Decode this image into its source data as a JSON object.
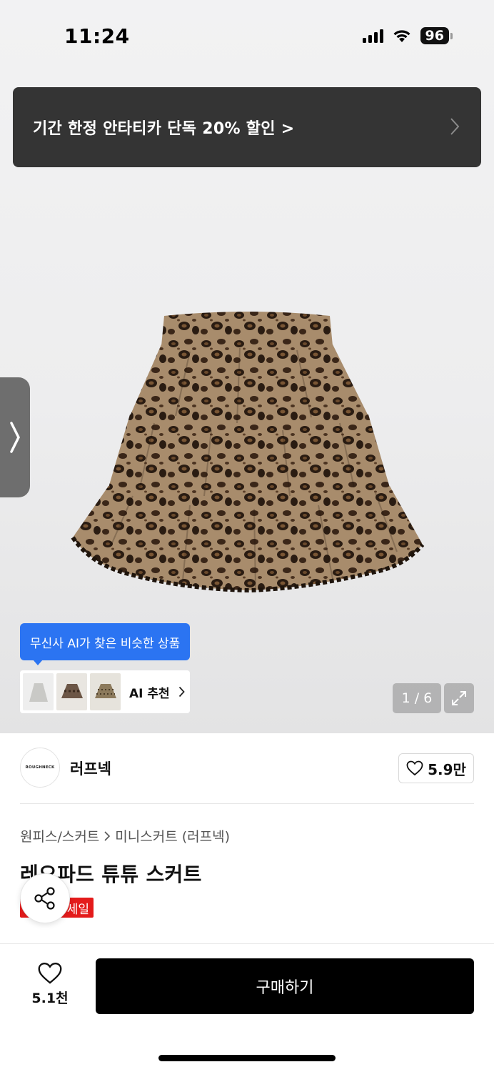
{
  "status_bar": {
    "time": "11:24",
    "battery": "96"
  },
  "promo_banner": {
    "text": "기간 한정 안타티카 단독 20% 할인 >"
  },
  "gallery": {
    "counter": "1 / 6",
    "ai_tooltip": "무신사 AI가 찾은 비슷한 상품",
    "ai_recommend_label": "AI 추천"
  },
  "brand": {
    "logo_text": "ROUGHNECK",
    "name": "러프넥",
    "likes": "5.9만"
  },
  "product": {
    "breadcrumb": [
      "원피스/스커트",
      "미니스커트 (러프넥)"
    ],
    "title": "레오파드 튜튜 스커트",
    "sale_badge": "세일"
  },
  "bottom_bar": {
    "wish_count": "5.1천",
    "buy_label": "구매하기"
  },
  "colors": {
    "promo_bg": "#343434",
    "ai_blue": "#2b74f2",
    "sale_red": "#e41b1b",
    "buy_bg": "#000000"
  }
}
